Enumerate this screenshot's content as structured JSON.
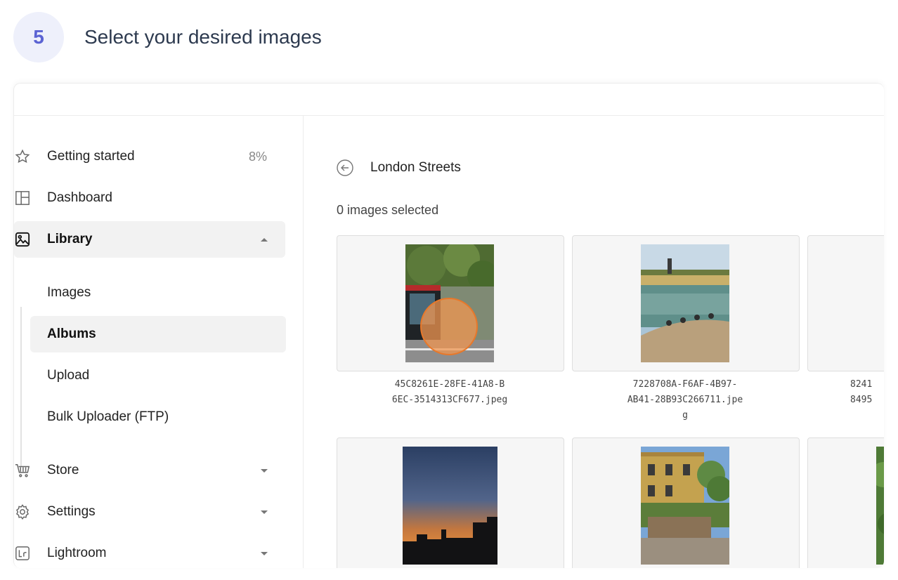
{
  "step": {
    "number": "5",
    "title": "Select your desired images"
  },
  "sidebar": {
    "getting_started": {
      "label": "Getting started",
      "meta": "8%"
    },
    "dashboard": {
      "label": "Dashboard"
    },
    "library": {
      "label": "Library"
    },
    "library_items": [
      {
        "label": "Images"
      },
      {
        "label": "Albums"
      },
      {
        "label": "Upload"
      },
      {
        "label": "Bulk Uploader (FTP)"
      }
    ],
    "store": {
      "label": "Store"
    },
    "settings": {
      "label": "Settings"
    },
    "lightroom": {
      "label": "Lightroom"
    }
  },
  "main": {
    "album_title": "London Streets",
    "selected_count": "0 images selected",
    "images": [
      {
        "caption_line1": "45C8261E-28FE-41A8-B",
        "caption_line2": "6EC-3514313CF677.jpeg",
        "caption_line3": ""
      },
      {
        "caption_line1": "7228708A-F6AF-4B97-",
        "caption_line2": "AB41-28B93C266711.jpe",
        "caption_line3": "g"
      },
      {
        "caption_line1": "8241",
        "caption_line2": "8495",
        "caption_line3": ""
      }
    ]
  },
  "colors": {
    "accent": "#5b63d3",
    "cursor": "#e8782a"
  }
}
